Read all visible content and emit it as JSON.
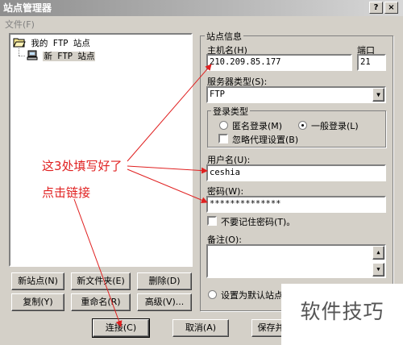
{
  "window": {
    "title": "站点管理器",
    "menu_file": "文件(F)"
  },
  "tree": {
    "root_label": "我的 FTP 站点",
    "child_label": "新 FTP 站点"
  },
  "left_buttons": {
    "new_site": "新站点(N)",
    "new_folder": "新文件夹(E)",
    "delete": "删除(D)",
    "copy": "复制(Y)",
    "rename": "重命名(R)",
    "advanced": "高级(V)..."
  },
  "site_info": {
    "group_title": "站点信息",
    "host_label": "主机名(H)",
    "host_value": "210.209.85.177",
    "port_label": "端口",
    "port_value": "21",
    "server_type_label": "服务器类型(S):",
    "server_type_value": "FTP",
    "login_type_title": "登录类型",
    "anonymous_label": "匿名登录(M)",
    "normal_label": "一般登录(L)",
    "ignore_proxy_label": "忽略代理设置(B)",
    "username_label": "用户名(U):",
    "username_value": "ceshia",
    "password_label": "密码(W):",
    "password_value": "**************",
    "no_remember_label": "不要记住密码(T)。",
    "notes_label": "备注(O):",
    "default_site_label": "设置为默认站点"
  },
  "bottom_buttons": {
    "connect": "连接(C)",
    "cancel": "取消(A)",
    "save": "保存并"
  },
  "annotations": {
    "fill_note": "这3处填写好了",
    "click_note": "点击链接",
    "color": "#e02020"
  },
  "watermark": "软件技巧"
}
